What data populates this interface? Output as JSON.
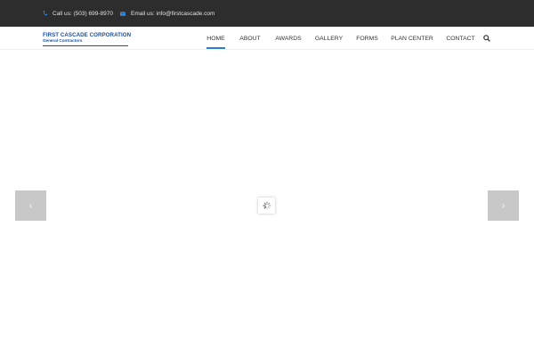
{
  "topbar": {
    "phone_icon": "phone-icon",
    "phone_text": "Call us: (503) 699-8970",
    "email_icon": "envelope-icon",
    "email_text": "Email us: info@firstcascade.com",
    "background": "#2d2d2d",
    "icon_color": "#3a8be0"
  },
  "logo": {
    "line1": "FIRST CASCADE CORPORATION",
    "line2": "General Contractors",
    "color": "#1c4f9c"
  },
  "nav": {
    "items": [
      {
        "label": "HOME",
        "active": true
      },
      {
        "label": "ABOUT",
        "active": false
      },
      {
        "label": "AWARDS",
        "active": false
      },
      {
        "label": "GALLERY",
        "active": false
      },
      {
        "label": "FORMS",
        "active": false
      },
      {
        "label": "PLAN CENTER",
        "active": false
      },
      {
        "label": "CONTACT",
        "active": false
      }
    ],
    "search_icon": "search-icon",
    "accent": "#2a7fd4"
  },
  "slider": {
    "prev_icon": "chevron-left-icon",
    "prev_glyph": "‹",
    "next_icon": "chevron-right-icon",
    "next_glyph": "›",
    "loader_icon": "spinner-icon"
  }
}
